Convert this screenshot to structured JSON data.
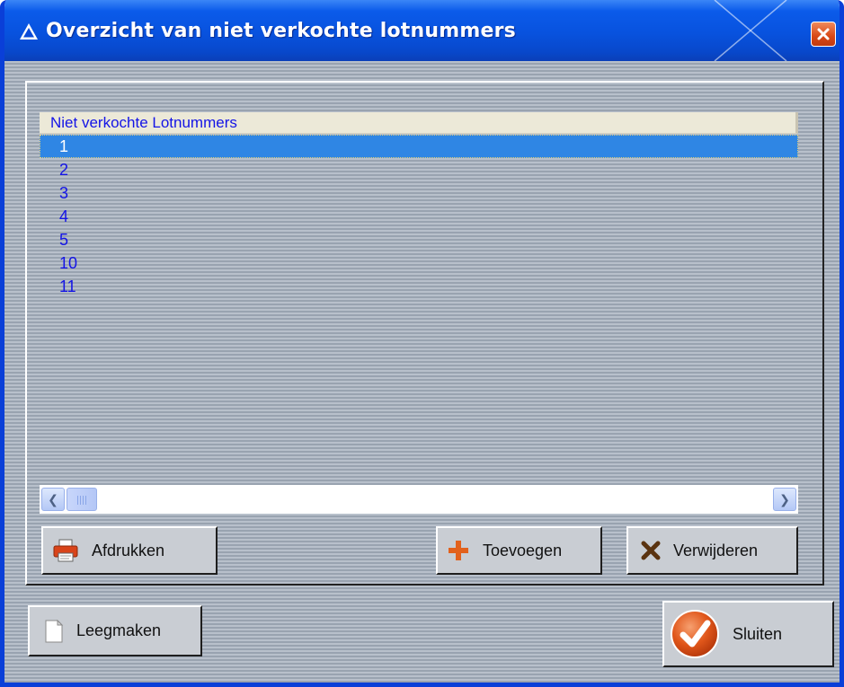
{
  "window": {
    "title": "Overzicht van niet verkochte lotnummers"
  },
  "list": {
    "header": "Niet verkochte Lotnummers",
    "rows": [
      "1",
      "2",
      "3",
      "4",
      "5",
      "10",
      "11"
    ],
    "selected_row": "1"
  },
  "buttons": {
    "afdrukken": {
      "label": "Afdrukken",
      "icon": "printer-icon"
    },
    "toevoegen": {
      "label": "Toevoegen",
      "icon": "plus-icon"
    },
    "verwijderen": {
      "label": "Verwijderen",
      "icon": "x-delete-icon"
    },
    "leegmaken": {
      "label": "Leegmaken",
      "icon": "blank-page-icon"
    },
    "sluiten": {
      "label": "Sluiten",
      "icon": "checkmark-icon"
    }
  },
  "colors": {
    "titlebar": "#0852de",
    "list_text": "#1414e6",
    "selection": "#2f86e4",
    "close_button": "#d84816",
    "accent_orange": "#e2611c"
  }
}
